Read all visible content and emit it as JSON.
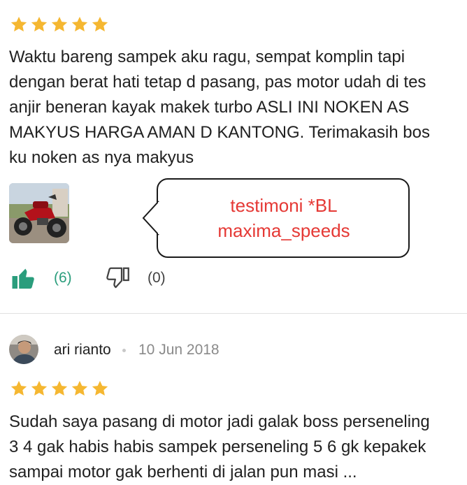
{
  "colors": {
    "star": "#f5b731",
    "like": "#2a9d7c",
    "bubble_text": "#e53935",
    "divider": "#e0e0e0"
  },
  "review1": {
    "rating": 5,
    "text_lines": [
      "Waktu bareng sampek aku ragu, sempat komplin tapi",
      "dengan berat hati tetap d pasang, pas motor udah di tes",
      "anjir beneran kayak makek turbo ASLI INI NOKEN AS",
      "MAKYUS HARGA AMAN D KANTONG. Terimakasih bos",
      "ku noken as nya makyus"
    ],
    "like_count": "(6)",
    "dislike_count": "(0)",
    "overlay_lines": [
      "testimoni *BL",
      "maxima_speeds"
    ]
  },
  "review2": {
    "reviewer": "ari rianto",
    "date": "10 Jun 2018",
    "rating": 5,
    "text_lines": [
      "Sudah saya pasang di motor jadi galak boss perseneling",
      "3 4 gak habis habis sampek perseneling 5 6 gk kepakek",
      "sampai motor gak berhenti di jalan pun masi ..."
    ]
  },
  "icons": {
    "star": "star-icon",
    "like": "thumbs-up-icon",
    "dislike": "thumbs-down-icon"
  }
}
